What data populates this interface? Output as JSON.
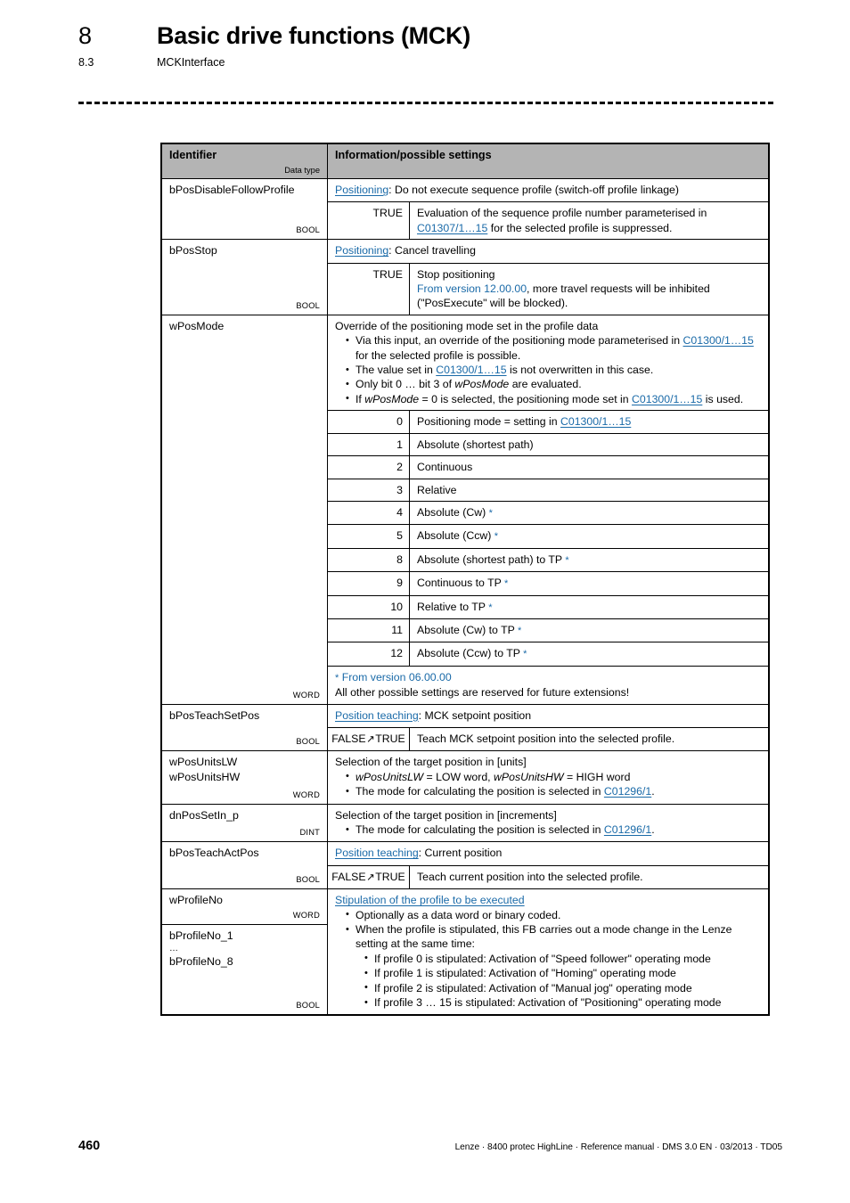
{
  "header": {
    "chapter_number": "8",
    "chapter_title": "Basic drive functions (MCK)",
    "section_number": "8.3",
    "section_title": "MCKInterface"
  },
  "table": {
    "columns": {
      "identifier": "Identifier",
      "identifier_sub": "Data type",
      "information": "Information/possible settings"
    },
    "rows": [
      {
        "identifier": "bPosDisableFollowProfile",
        "data_type": "BOOL",
        "link_head": "Positioning",
        "desc": ": Do not execute sequence profile (switch-off profile linkage)",
        "sub": [
          {
            "value": "TRUE",
            "text_1": "Evaluation of the sequence profile number parameterised in",
            "link": "C01307/1…15",
            "text_2": "for the selected profile is suppressed."
          }
        ]
      },
      {
        "identifier": "bPosStop",
        "data_type": "BOOL",
        "link_head": "Positioning",
        "desc": ": Cancel travelling",
        "sub": [
          {
            "value": "TRUE",
            "line_1": "Stop positioning",
            "version": "From version 12.00.00",
            "line_2": ", more travel requests will be inhibited",
            "line_3": "(\"PosExecute\" will be blocked)."
          }
        ]
      },
      {
        "identifier": "wPosMode",
        "data_type": "WORD",
        "desc": "Override of the positioning mode set in the profile data",
        "bullets": [
          {
            "text_1": "Via this input, an override of the positioning mode parameterised in",
            "link": "C01300/1…15",
            "text_2": "for the selected profile is possible."
          },
          {
            "text_1": "The value set in",
            "link": "C01300/1…15",
            "text_2": "is not overwritten in this case."
          },
          {
            "text_1": "Only bit 0 … bit 3 of",
            "italic": "wPosMode",
            "text_2": "are evaluated."
          },
          {
            "text_1": "If",
            "italic": "wPosMode",
            "text_2": "= 0 is selected, the positioning mode set in",
            "link": "C01300/1…15",
            "text_3": "is used."
          }
        ],
        "modes": [
          {
            "value": "0",
            "label": "Positioning mode = setting in ",
            "link": "C01300/1…15",
            "starred": false
          },
          {
            "value": "1",
            "label": "Absolute (shortest path)",
            "starred": false
          },
          {
            "value": "2",
            "label": "Continuous",
            "starred": false
          },
          {
            "value": "3",
            "label": "Relative",
            "starred": false
          },
          {
            "value": "4",
            "label": "Absolute (Cw)",
            "starred": true
          },
          {
            "value": "5",
            "label": "Absolute (Ccw)",
            "starred": true
          },
          {
            "value": "8",
            "label": "Absolute (shortest path) to TP",
            "starred": true
          },
          {
            "value": "9",
            "label": "Continuous to TP",
            "starred": true
          },
          {
            "value": "10",
            "label": "Relative to TP",
            "starred": true
          },
          {
            "value": "11",
            "label": "Absolute (Cw) to TP",
            "starred": true
          },
          {
            "value": "12",
            "label": "Absolute (Ccw) to TP",
            "starred": true
          }
        ],
        "footnote_star": "*",
        "footnote_version": "From version 06.00.00",
        "footnote_text": "All other possible settings are reserved for future extensions!"
      },
      {
        "identifier": "bPosTeachSetPos",
        "data_type": "BOOL",
        "link_head": "Position teaching",
        "desc": ": MCK setpoint position",
        "sub": [
          {
            "value_false": "FALSE",
            "value_arrow": "↗",
            "value_true": "TRUE",
            "text": "Teach MCK setpoint position into the selected profile."
          }
        ]
      },
      {
        "identifier_line_1": "wPosUnitsLW",
        "identifier_line_2": "wPosUnitsHW",
        "data_type": "WORD",
        "desc": "Selection of the target position in [units]",
        "bullets": [
          {
            "italic_1": "wPosUnitsLW",
            "text_1": "= LOW word,",
            "italic_2": "wPosUnitsHW",
            "text_2": "= HIGH word"
          },
          {
            "text_1": "The mode for calculating the position is selected in",
            "link": "C01296/1",
            "text_2": "."
          }
        ]
      },
      {
        "identifier": "dnPosSetIn_p",
        "data_type": "DINT",
        "desc": "Selection of the target position in [increments]",
        "bullets": [
          {
            "text_1": "The mode for calculating the position is selected in",
            "link": "C01296/1",
            "text_2": "."
          }
        ]
      },
      {
        "identifier": "bPosTeachActPos",
        "data_type": "BOOL",
        "link_head": "Position teaching",
        "desc": ": Current position",
        "sub": [
          {
            "value_false": "FALSE",
            "value_arrow": "↗",
            "value_true": "TRUE",
            "text": "Teach current position into the selected profile."
          }
        ]
      },
      {
        "identifier": "wProfileNo",
        "data_type": "WORD",
        "identifier_2_line_1": "bProfileNo_1",
        "identifier_2_dots": "…",
        "identifier_2_line_2": "bProfileNo_8",
        "data_type_2": "BOOL",
        "link_head": "Stipulation of the profile to be executed",
        "bullets": [
          {
            "text_1": "Optionally as a data word or binary coded."
          },
          {
            "text_1": "When the profile is stipulated, this FB carries out a mode change in the Lenze setting at the same time:",
            "sub_bullets": [
              "If profile 0 is stipulated: Activation of \"Speed follower\" operating mode",
              "If profile 1 is stipulated: Activation of \"Homing\" operating mode",
              "If profile 2 is stipulated: Activation of \"Manual jog\" operating mode",
              "If profile 3 … 15 is stipulated: Activation of \"Positioning\" operating mode"
            ]
          }
        ]
      }
    ]
  },
  "footer": {
    "page_number": "460",
    "text": "Lenze · 8400 protec HighLine · Reference manual · DMS 3.0 EN · 03/2013 · TD05"
  },
  "colors": {
    "link": "#1a6aa8",
    "header_fill": "#b4b4b4"
  }
}
